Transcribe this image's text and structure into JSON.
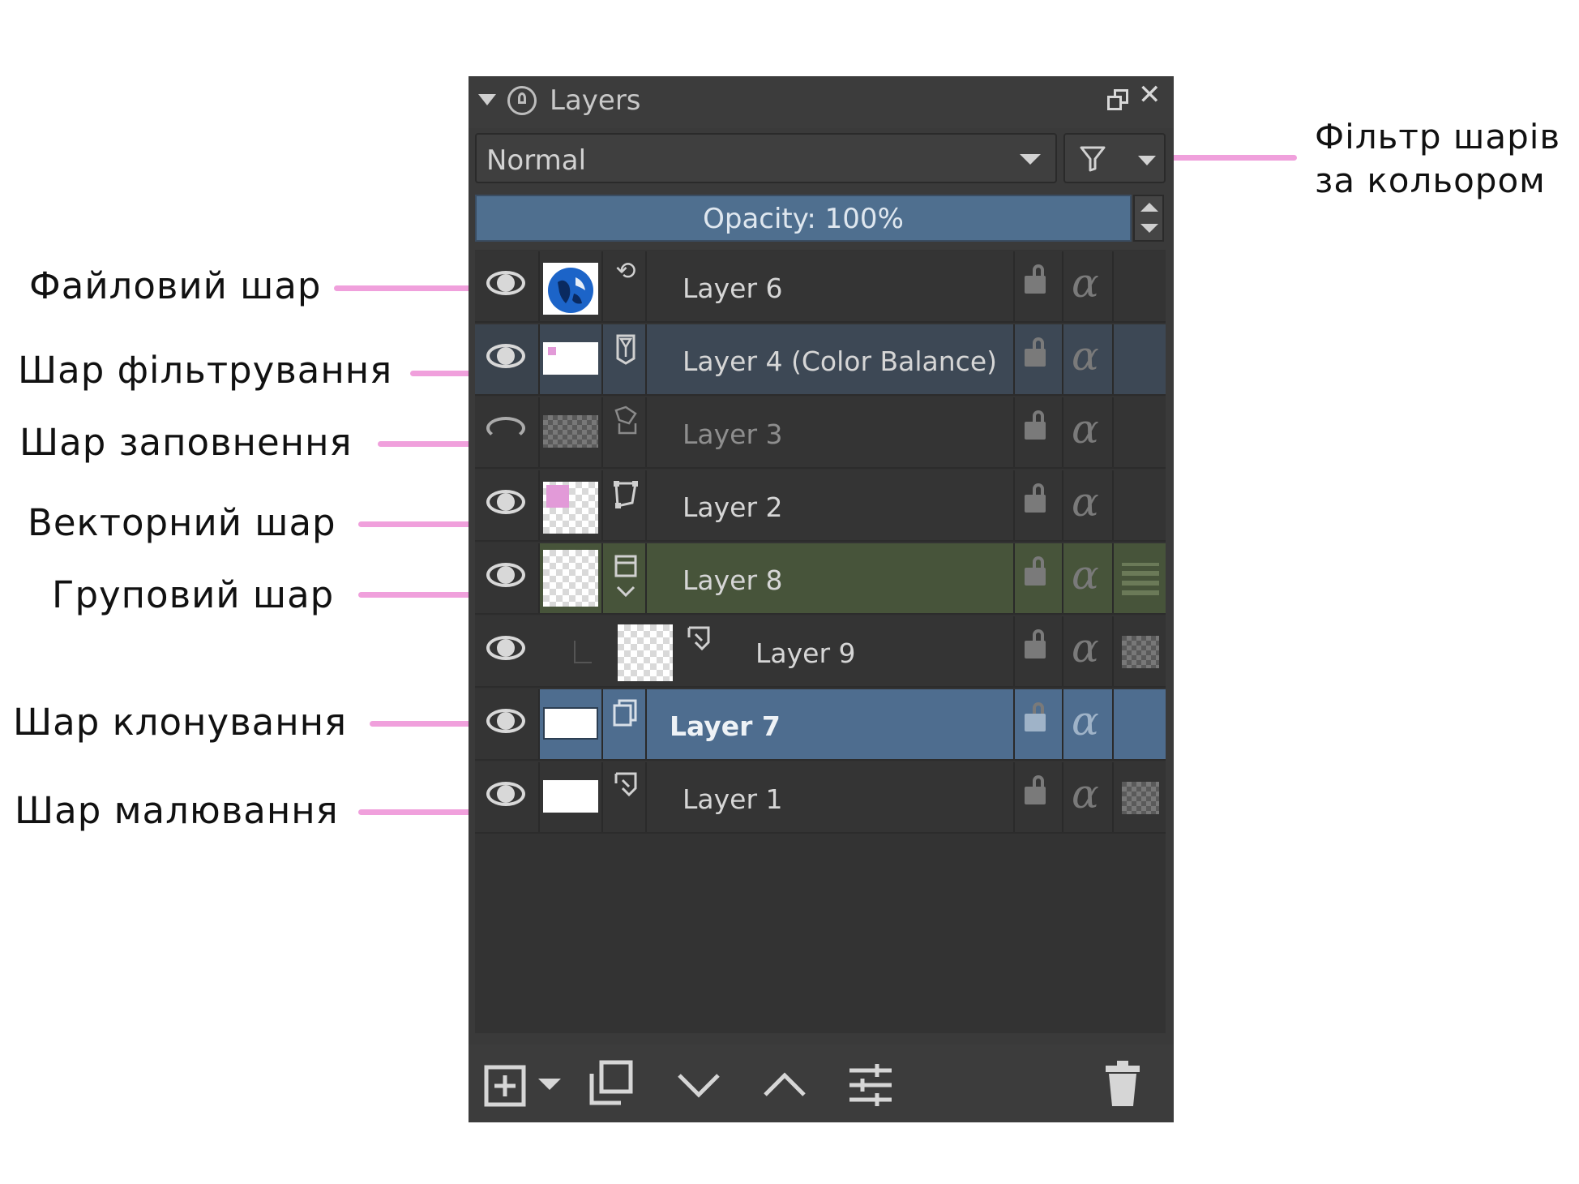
{
  "annotations": {
    "left": [
      "Файловий шар",
      "Шар фільтрування",
      "Шар заповнення",
      "Векторний шар",
      "Груповий шар",
      "Шар клонування",
      "Шар малювання"
    ],
    "right_line1": "Фільтр шарів",
    "right_line2": "за кольором"
  },
  "docker": {
    "title": "Layers",
    "blend_mode": "Normal",
    "opacity_label": "Opacity:  100%"
  },
  "layers": [
    {
      "name": "Layer 6",
      "type": "file",
      "visible": true
    },
    {
      "name": "Layer 4 (Color Balance)",
      "type": "filter",
      "visible": true
    },
    {
      "name": "Layer 3",
      "type": "fill",
      "visible": false
    },
    {
      "name": "Layer 2",
      "type": "vector",
      "visible": true
    },
    {
      "name": "Layer 8",
      "type": "group",
      "visible": true
    },
    {
      "name": "Layer 9",
      "type": "paint",
      "visible": true
    },
    {
      "name": "Layer 7",
      "type": "clone",
      "visible": true
    },
    {
      "name": "Layer 1",
      "type": "paint",
      "visible": true
    }
  ],
  "colors": {
    "annotation_line": "#f0a0dc",
    "panel_bg": "#3a3a3a",
    "selected_row": "#4e6d8f",
    "group_row": "#47543a",
    "opacity_bar": "#4f6f8f"
  },
  "icons": {
    "bottom": [
      "add-layer-icon",
      "duplicate-layer-icon",
      "move-down-icon",
      "move-up-icon",
      "properties-icon",
      "delete-icon"
    ]
  }
}
